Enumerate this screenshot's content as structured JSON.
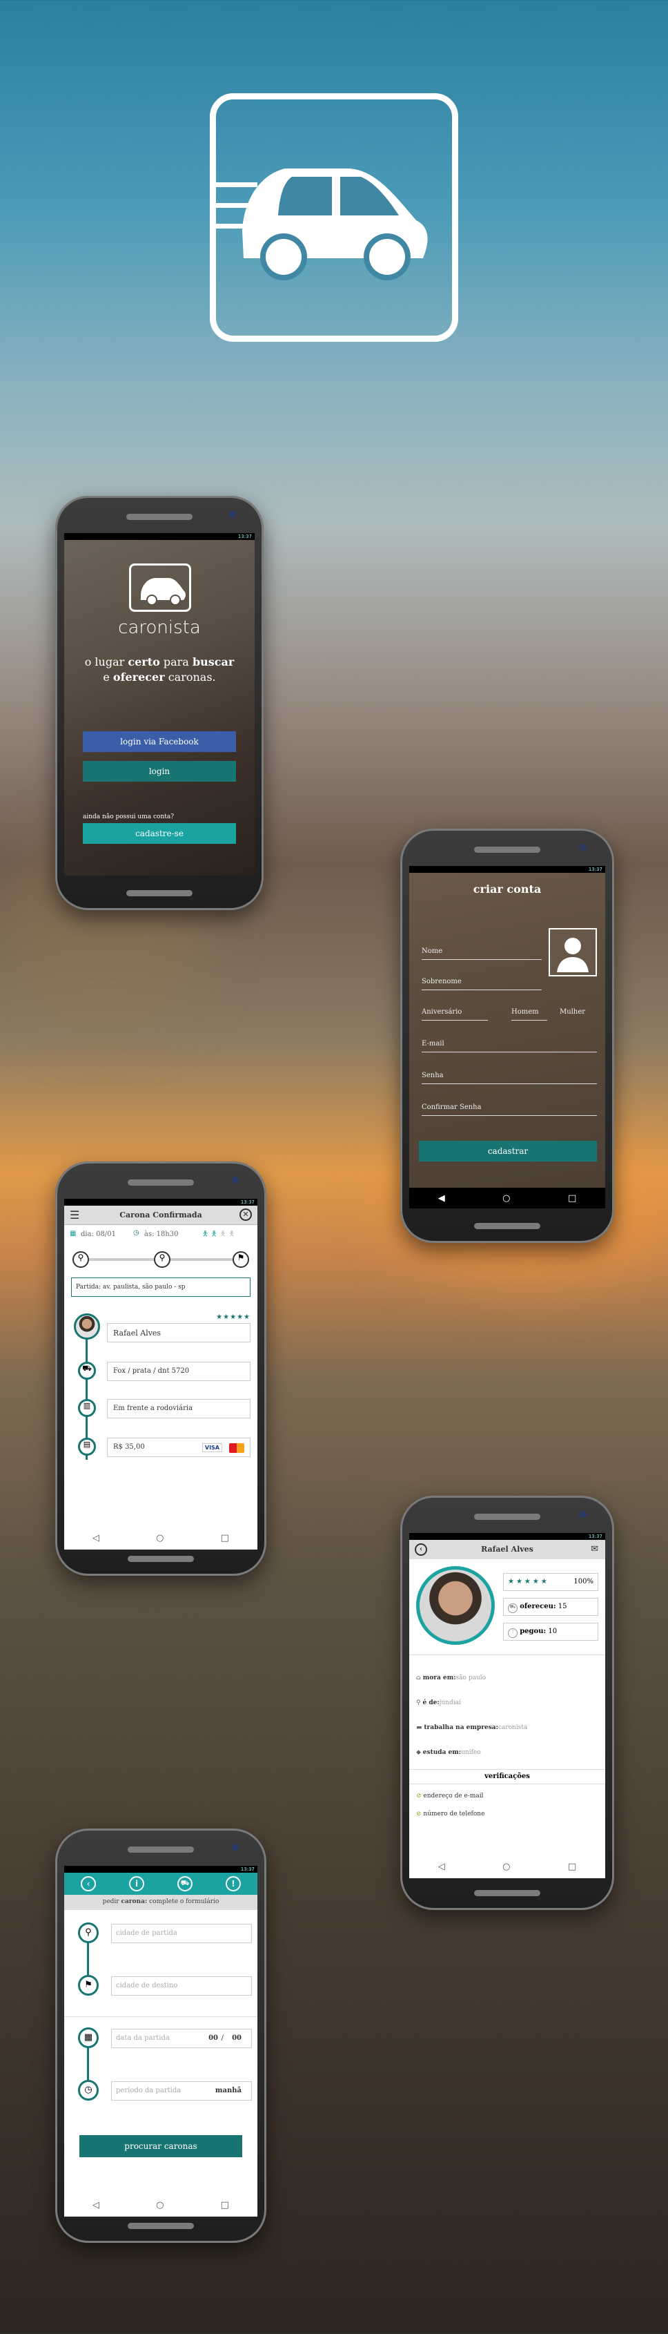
{
  "login": {
    "status_time": "13:37",
    "brand": "caronista",
    "tagline_1": "o lugar",
    "tagline_2": "certo",
    "tagline_3": "para",
    "tagline_4": "buscar",
    "tagline_5": "e",
    "tagline_6": "oferecer",
    "tagline_7": "caronas.",
    "facebook_label": "login via Facebook",
    "login_label": "login",
    "no_account": "ainda não possui uma conta?",
    "signup_label": "cadastre-se"
  },
  "signup": {
    "status_time": "13:37",
    "title": "criar conta",
    "name_ph": "Nome",
    "surname_ph": "Sobrenome",
    "birthday_ph": "Aniversário",
    "male": "Homem",
    "female": "Mulher",
    "email_ph": "E-mail",
    "password_ph": "Senha",
    "confirm_ph": "Confirmar Senha",
    "submit": "cadastrar"
  },
  "ride": {
    "status_time": "13:37",
    "title": "Carona Confirmada",
    "date": "dia: 08/01",
    "time": "às: 18h30",
    "departure": "Partida: av. paulista, são paulo - sp",
    "driver_name": "Rafael Alves",
    "car": "Fox / prata / dnt 5720",
    "meeting": "Em frente a rodoviária",
    "price": "R$ 35,00",
    "visa": "VISA",
    "rating_stars": 5
  },
  "profile": {
    "status_time": "13:37",
    "name": "Rafael Alves",
    "rating": "100%",
    "offered_label": "ofereceu:",
    "offered_value": "15",
    "took_label": "pegou:",
    "took_value": "10",
    "lives_label": "mora em:",
    "lives_value": "são paulo",
    "from_label": "é de:",
    "from_value": "jundiaí",
    "works_label": "trabalha na empresa:",
    "works_value": "caronista",
    "studies_label": "estuda em:",
    "studies_value": "unifeo",
    "verifications": "verificações",
    "ver_email": "endereço de e-mail",
    "ver_phone": "número de telefone",
    "rating_stars": 5
  },
  "request": {
    "status_time": "13:37",
    "header_1": "pedir",
    "header_2": "carona:",
    "header_3": "complete o formulário",
    "origin_ph": "cidade de partida",
    "dest_ph": "cidade de destino",
    "date_ph": "data da partida",
    "hour_val": "00",
    "min_val": "00",
    "period_ph": "período da partida",
    "period_val": "manhã",
    "submit": "procurar caronas"
  },
  "colors": {
    "teal": "#187572",
    "teal_light": "#1aa3a0",
    "facebook": "#3b5ea8"
  }
}
